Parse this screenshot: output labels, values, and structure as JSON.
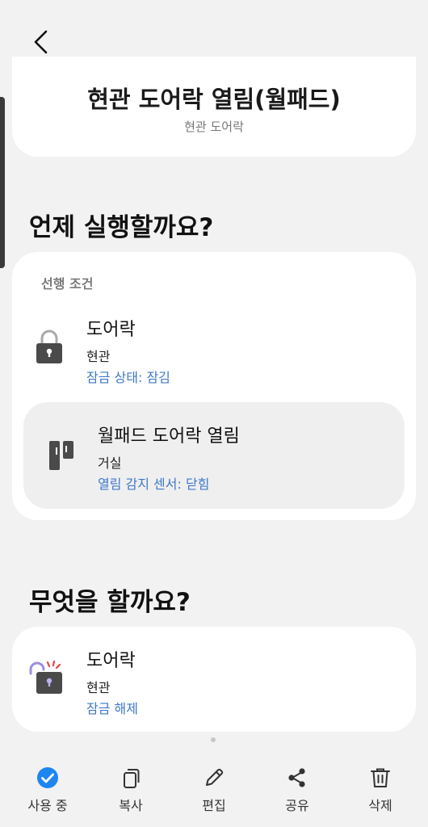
{
  "rule": {
    "title": "현관 도어락 열림(월패드)",
    "subtitle": "현관 도어락"
  },
  "when": {
    "heading": "언제 실행할까요?",
    "precondition_label": "선행 조건",
    "items": [
      {
        "icon": "lock-icon",
        "title": "도어락",
        "location": "현관",
        "status": "잠금 상태: 잠김"
      },
      {
        "icon": "door-sensor-icon",
        "title": "월패드 도어락 열림",
        "location": "거실",
        "status": "열림 감지 센서: 닫힘"
      }
    ]
  },
  "then": {
    "heading": "무엇을 할까요?",
    "items": [
      {
        "icon": "unlock-icon",
        "title": "도어락",
        "location": "현관",
        "status": "잠금 해제"
      }
    ]
  },
  "bottom_bar": {
    "items": [
      {
        "icon": "check-circle-icon",
        "label": "사용 중"
      },
      {
        "icon": "copy-icon",
        "label": "복사"
      },
      {
        "icon": "edit-icon",
        "label": "편집"
      },
      {
        "icon": "share-icon",
        "label": "공유"
      },
      {
        "icon": "trash-icon",
        "label": "삭제"
      }
    ]
  },
  "colors": {
    "background": "#f2f2f2",
    "accent": "#3f78c8",
    "active": "#1d86f0"
  }
}
